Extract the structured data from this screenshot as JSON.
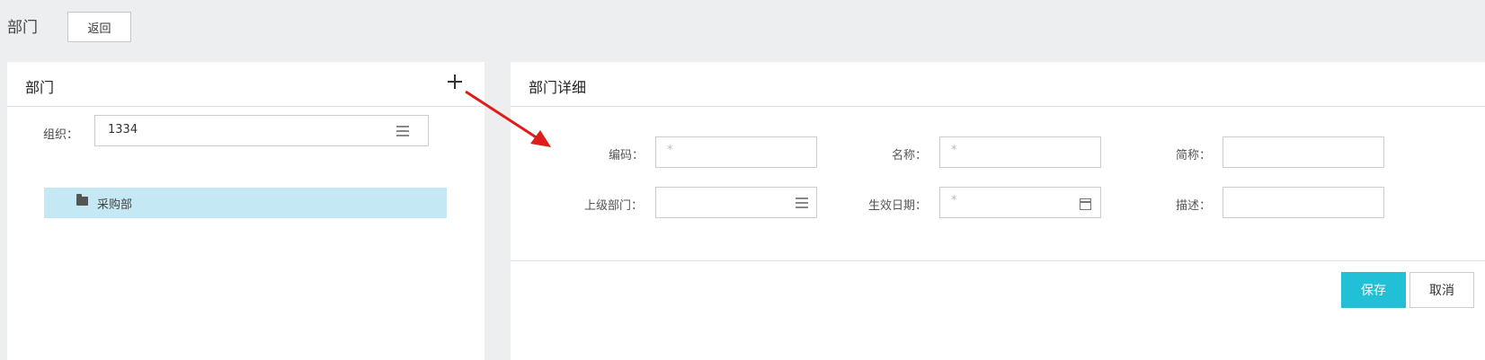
{
  "header": {
    "title": "部门",
    "back_label": "返回"
  },
  "left_panel": {
    "title": "部门",
    "add_icon": "plus-icon",
    "org_label": "组织：",
    "org_value": "1334",
    "org_icon": "list-icon",
    "tree": [
      {
        "label": "采购部",
        "icon": "folder-icon"
      }
    ]
  },
  "right_panel": {
    "title": "部门详细",
    "fields": {
      "code": {
        "label": "编码：",
        "placeholder": "*"
      },
      "name": {
        "label": "名称：",
        "placeholder": "*"
      },
      "short_name": {
        "label": "简称：",
        "placeholder": ""
      },
      "parent": {
        "label": "上级部门：",
        "placeholder": "",
        "icon": "list-icon"
      },
      "effective_date": {
        "label": "生效日期：",
        "placeholder": "*",
        "icon": "calendar-icon"
      },
      "description": {
        "label": "描述：",
        "placeholder": ""
      }
    },
    "save_label": "保存",
    "cancel_label": "取消"
  },
  "colors": {
    "accent": "#22c0d6",
    "selected_row": "#c4e9f4",
    "annotation_arrow": "#e01b1b",
    "page_background": "#eceef0"
  }
}
